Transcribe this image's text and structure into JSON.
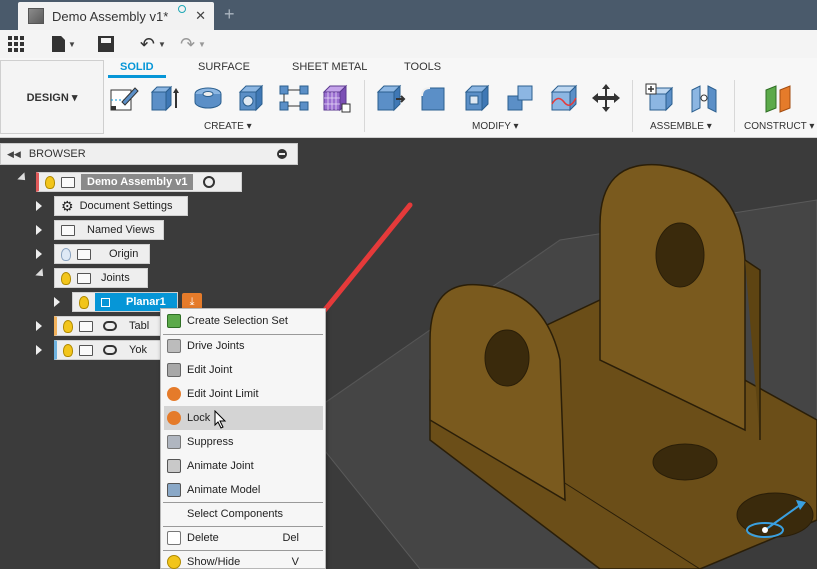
{
  "window": {
    "tab_title": "Demo Assembly v1*",
    "tab_close": "✕",
    "new_tab": "+"
  },
  "toolbar_tabs": [
    {
      "label": "SOLID",
      "active": true
    },
    {
      "label": "SURFACE",
      "active": false
    },
    {
      "label": "SHEET METAL",
      "active": false
    },
    {
      "label": "TOOLS",
      "active": false
    }
  ],
  "workspace": {
    "label": "DESIGN ▾"
  },
  "groups": {
    "create": "CREATE ▾",
    "modify": "MODIFY ▾",
    "assemble": "ASSEMBLE ▾",
    "construct": "CONSTRUCT ▾"
  },
  "browser": {
    "title": "BROWSER",
    "root": "Demo Assembly v1",
    "items": [
      {
        "label": "Document Settings"
      },
      {
        "label": "Named Views"
      },
      {
        "label": "Origin"
      },
      {
        "label": "Joints"
      },
      {
        "label": "Planar1"
      },
      {
        "label": "Tabl"
      },
      {
        "label": "Yok"
      }
    ]
  },
  "context_menu": {
    "items": [
      {
        "label": "Create Selection Set",
        "shortcut": ""
      },
      {
        "label": "Drive Joints",
        "shortcut": ""
      },
      {
        "label": "Edit Joint",
        "shortcut": ""
      },
      {
        "label": "Edit Joint Limit",
        "shortcut": ""
      },
      {
        "label": "Lock",
        "shortcut": ""
      },
      {
        "label": "Suppress",
        "shortcut": ""
      },
      {
        "label": "Animate Joint",
        "shortcut": ""
      },
      {
        "label": "Animate Model",
        "shortcut": ""
      },
      {
        "label": "Select Components",
        "shortcut": ""
      },
      {
        "label": "Delete",
        "shortcut": "Del"
      },
      {
        "label": "Show/Hide",
        "shortcut": "V"
      }
    ]
  },
  "colors": {
    "accent": "#0696d7",
    "part": "#7a5a1e",
    "arrow": "#e53a3a"
  }
}
